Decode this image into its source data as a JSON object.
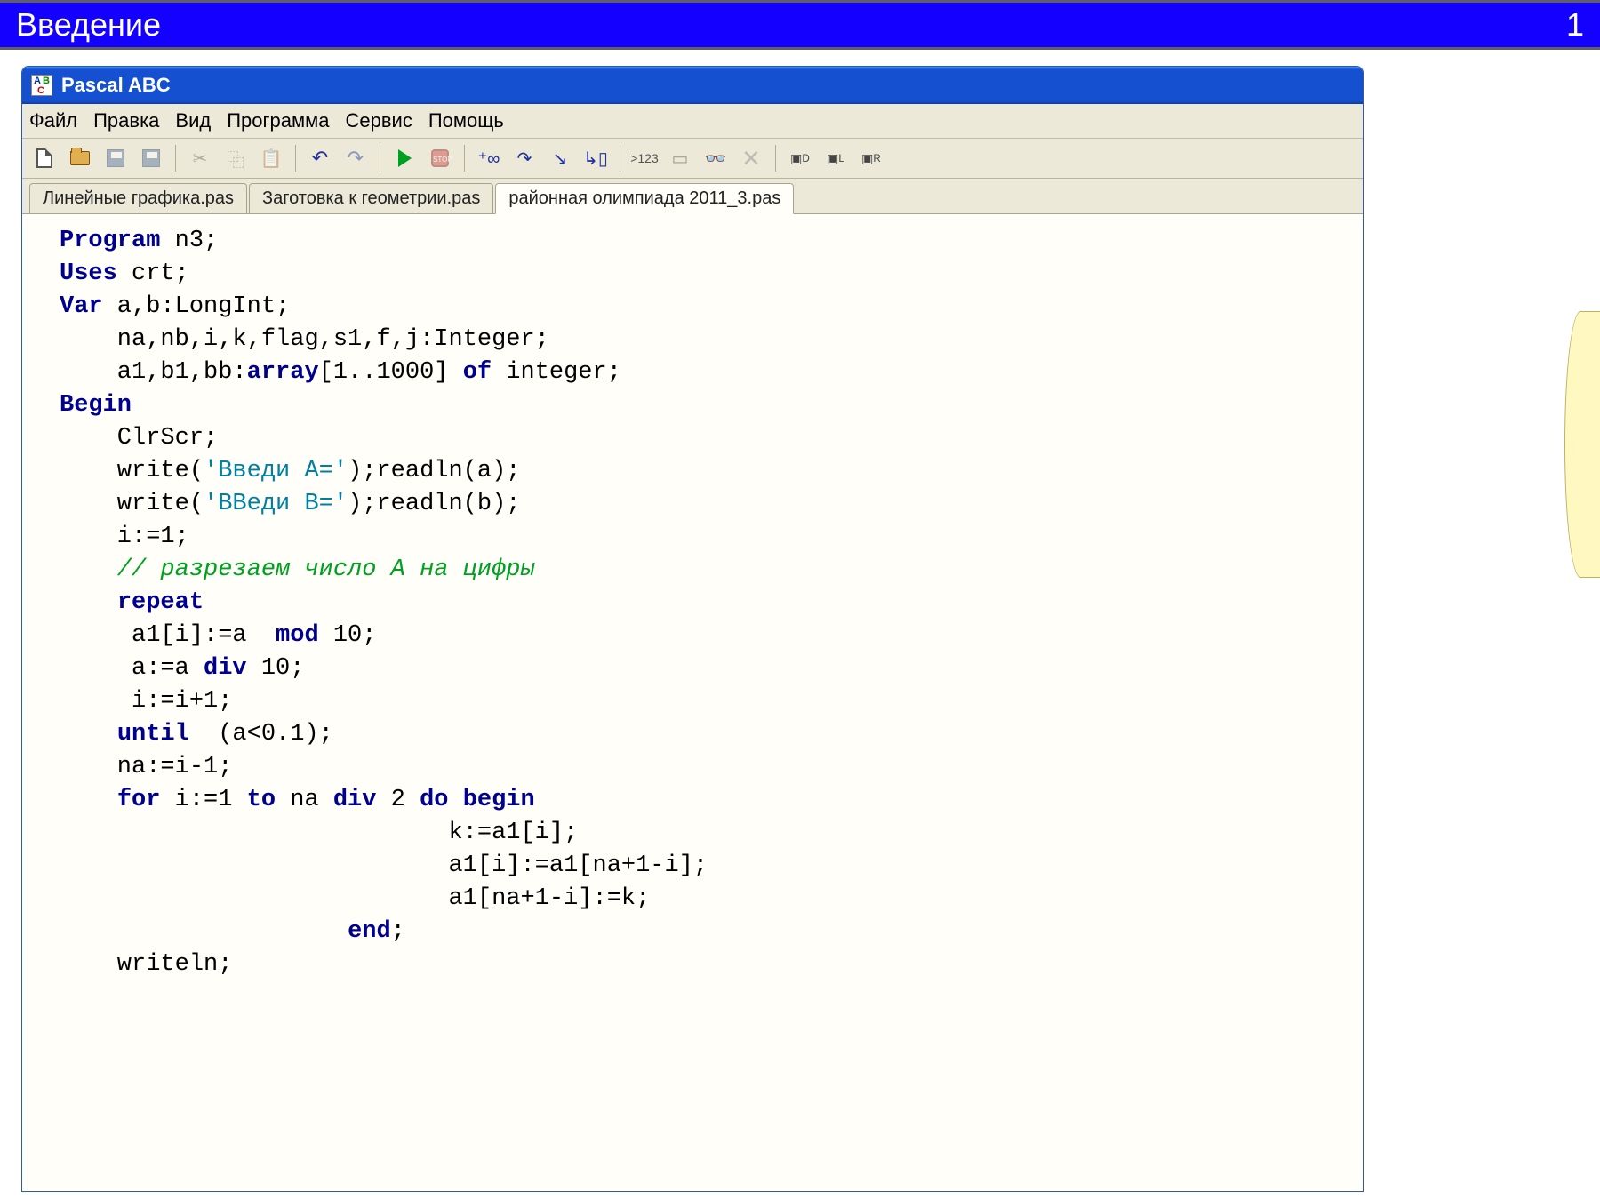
{
  "slide": {
    "title": "Введение",
    "number": "1"
  },
  "window": {
    "title": "Pascal ABC"
  },
  "menu": {
    "file": "Файл",
    "edit": "Правка",
    "view": "Вид",
    "program": "Программа",
    "tools": "Сервис",
    "help": "Помощь"
  },
  "toolbar": {
    "watch_label": ">123"
  },
  "tabs": {
    "t1": "Линейные графика.pas",
    "t2": "Заготовка к геометрии.pas",
    "t3": "районная олимпиада 2011_3.pas"
  },
  "code": {
    "kw_program": "Program",
    "progname": " n3;",
    "kw_uses": "Uses",
    "uses_val": " crt;",
    "kw_var": "Var",
    "var1": " a,b:LongInt;",
    "var2": "    na,nb,i,k,flag,s1,f,j:Integer;",
    "var3a": "    a1,b1,bb:",
    "kw_array": "array",
    "var3b": "[1..1000] ",
    "kw_of": "of",
    "var3c": " integer;",
    "kw_begin": "Begin",
    "l1": "    ClrScr;",
    "l2a": "    write(",
    "l2s": "'Введи A='",
    "l2b": ");readln(a);",
    "l3a": "    write(",
    "l3s": "'ВВеди B='",
    "l3b": ");readln(b);",
    "l4": "    i:=1;",
    "comment": "    // разрезаем число A на цифры",
    "kw_repeat": "repeat",
    "r1a": "     a1[i]:=a  ",
    "kw_mod": "mod",
    "r1b": " 10;",
    "r2a": "     a:=a ",
    "kw_div1": "div",
    "r2b": " 10;",
    "r3": "     i:=i+1;",
    "kw_until": "until",
    "u1": "  (a<0.1);",
    "l5": "    na:=i-1;",
    "kw_for": "for",
    "f1": " i:=1 ",
    "kw_to": "to",
    "f2": " na ",
    "kw_div2": "div",
    "f3": " 2 ",
    "kw_do": "do",
    "kw_begin2": "begin",
    "fb1": "                           k:=a1[i];",
    "fb2": "                           a1[i]:=a1[na+1-i];",
    "fb3": "                           a1[na+1-i]:=k;",
    "kw_end": "end",
    "end_semi": ";",
    "l6": "    writeln;"
  }
}
